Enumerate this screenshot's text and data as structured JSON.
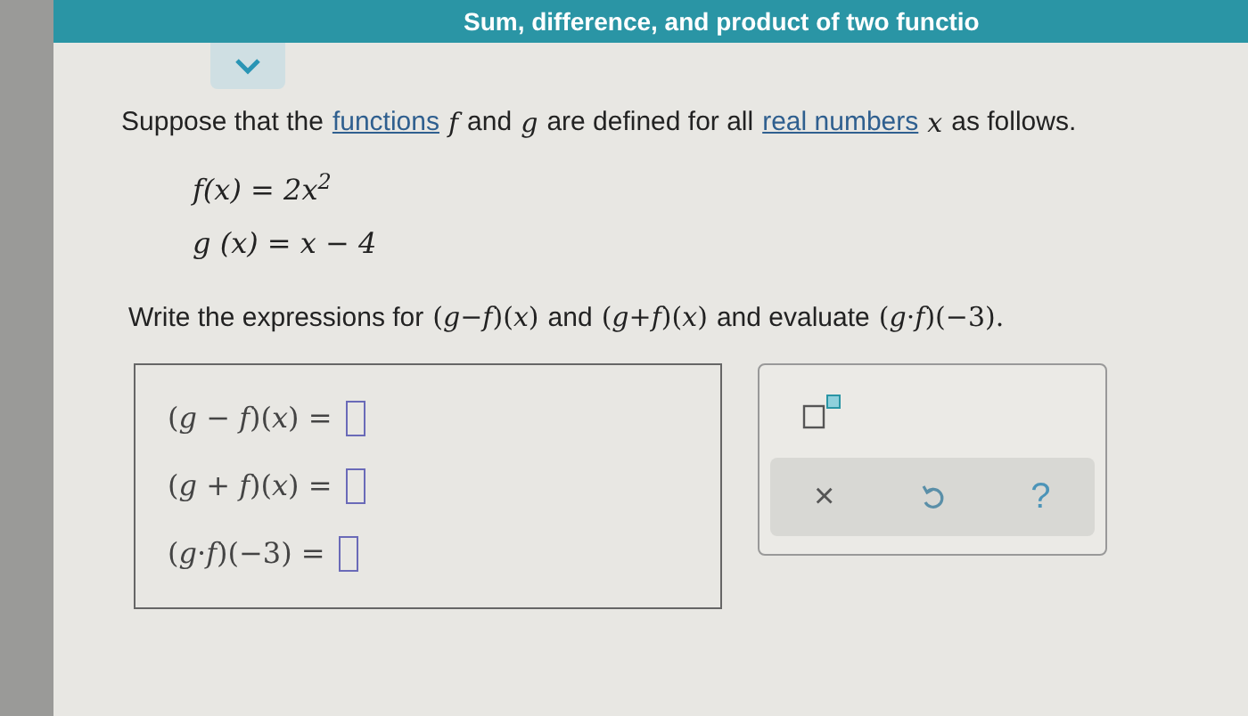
{
  "header": {
    "title": "Sum, difference, and product of two functio"
  },
  "intro": [
    {
      "kind": "text",
      "text": "Suppose that the"
    },
    {
      "kind": "link",
      "text": "functions"
    },
    {
      "kind": "math",
      "text": "*f*"
    },
    {
      "kind": "text",
      "text": "and"
    },
    {
      "kind": "math",
      "text": "*g*"
    },
    {
      "kind": "text",
      "text": "are defined for all"
    },
    {
      "kind": "link",
      "text": "real numbers"
    },
    {
      "kind": "math",
      "text": "*x*"
    },
    {
      "kind": "text",
      "text": "as follows."
    }
  ],
  "definitions": [
    "f(x) = 2x$^{2}$",
    "g (x) = x − 4"
  ],
  "instruction": [
    {
      "kind": "text",
      "text": "Write the expressions for"
    },
    {
      "kind": "math",
      "text": "(*g*−*f*)(*x*)"
    },
    {
      "kind": "text",
      "text": "and"
    },
    {
      "kind": "math",
      "text": "(*g*+*f*)(*x*)"
    },
    {
      "kind": "text",
      "text": "and evaluate"
    },
    {
      "kind": "math",
      "text": "(*g*·*f*)(−3)."
    }
  ],
  "answers": [
    {
      "label": "(*g* − *f*)(*x*) ="
    },
    {
      "label": "(*g* + *f*)(*x*) ="
    },
    {
      "label": "(*g*·*f*)(−3) ="
    }
  ],
  "toolbar": {
    "actions": [
      {
        "kind": "clear",
        "label": "×"
      },
      {
        "kind": "undo"
      },
      {
        "kind": "help",
        "label": "?"
      }
    ]
  }
}
